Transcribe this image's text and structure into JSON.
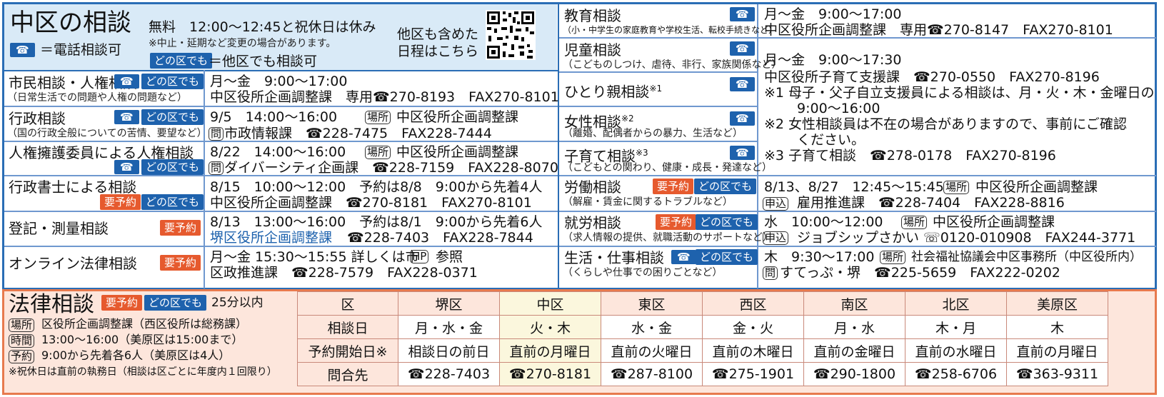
{
  "header": {
    "title": "中区の相談",
    "free_hours": "無料　12:00〜12:45と祝休日は休み",
    "change_note": "※中止・延期など変更の場合があります。",
    "tel_icon_label": "☎",
    "tel_legend": "＝電話相談可",
    "anywhere_label": "どの区でも",
    "anywhere_legend": "＝他区でも相談可",
    "schedule_line1": "他区も含めた",
    "schedule_line2": "日程はこちら"
  },
  "badges": {
    "tel": "☎",
    "anywhere": "どの区でも",
    "reserve": "要予約"
  },
  "left_rows": [
    {
      "title": "市民相談・人権相談",
      "sub": "（日常生活での問題や人権の問題など）",
      "line1": "月〜金　9:00〜17:00",
      "line2": "中区役所企画調整課　専用☎270-8193　FAX270-8101"
    },
    {
      "title": "行政相談",
      "sub": "（国の行政全般についての苦情、要望など）",
      "line1a": "9/5　14:00〜16:00",
      "place": "場所",
      "line1b": "中区役所企画調整課",
      "ask": "問",
      "line2": "市政情報課　☎228-7475　FAX228-7444"
    },
    {
      "title": "人権擁護委員による人権相談",
      "line1a": "8/22　14:00〜16:00",
      "place": "場所",
      "line1b": "中区役所企画調整課",
      "ask": "問",
      "line2": "ダイバーシティ企画課　☎228-7159　FAX228-8070"
    },
    {
      "title": "行政書士による相談",
      "line1": "8/15　10:00〜12:00　予約は8/8　9:00から先着4人",
      "line2": "中区役所企画調整課　☎270-8181　FAX270-8101"
    },
    {
      "title": "登記・測量相談",
      "line1": "8/13　13:00〜16:00　予約は8/1　9:00から先着6人",
      "line2a": "堺区役所企画調整課",
      "line2b": "☎228-7403　FAX228-7844"
    },
    {
      "title": "オンライン法律相談",
      "line1a": "月〜金 15:30〜15:55 詳しくは市",
      "hp": "HP",
      "line1b": "参照",
      "line2": "区政推進課　☎228-7579　FAX228-0371"
    }
  ],
  "right_rows": [
    {
      "title": "教育相談",
      "sub": "（小・中学生の家庭教育や学校生活、転校手続きなど）",
      "line1": "月〜金　9:00〜17:00",
      "line2": "中区役所企画調整課　専用☎270-8147　FAX270-8101"
    },
    {
      "title": "児童相談",
      "sub": "（こどものしつけ、虐待、非行、家族関係など）"
    },
    {
      "title": "ひとり親相談",
      "mark": "※1"
    },
    {
      "title": "女性相談",
      "mark": "※2",
      "sub": "（離婚、配偶者からの暴力、生活など）"
    },
    {
      "title": "子育て相談",
      "mark": "※3",
      "sub": "（こどもとの関わり、健康・成長・発達など）"
    },
    {
      "title": "労働相談",
      "sub": "（解雇・賃金に関するトラブルなど）",
      "line1a": "8/13、8/27　12:45〜15:45",
      "place": "場所",
      "line1b": "中区役所企画調整課",
      "apply": "申込",
      "line2": "雇用推進課　☎228-7404　FAX228-8816"
    },
    {
      "title": "就労相談",
      "sub": "（求人情報の提供、就職活動のサポートなど）",
      "line1a": "水　10:00〜12:00",
      "place": "場所",
      "line1b": "中区役所企画調整課",
      "apply": "申込",
      "line2": "ジョブシップさかい ☏0120-010908　FAX244-3771"
    },
    {
      "title": "生活・仕事相談",
      "sub": "（くらしや仕事での困りごとなど）",
      "line1a": "木　9:30〜17:00",
      "place": "場所",
      "line1b": "社会福祉協議会中区事務所（中区役所内）",
      "ask": "問",
      "line2": "すてっぷ・堺　☎225-5659　FAX222-0202"
    }
  ],
  "child_block": {
    "l1": "月〜金　9:00〜17:30",
    "l2": "中区役所子育て支援課　☎270-0550　FAX270-8196",
    "l3": "※1 母子・父子自立支援員による相談は、月・火・木・金曜日の",
    "l4": "9:00〜16:00",
    "l5": "※2 女性相談員は不在の場合がありますので、事前にご確認",
    "l6": "ください。",
    "l7": "※3 子育て相談　☎278-0178　FAX270-8196"
  },
  "law": {
    "title": "法律相談",
    "duration": "25分以内",
    "place_tag": "場所",
    "place": "区役所企画調整課（西区役所は総務課）",
    "time_tag": "時間",
    "time": "13:00〜16:00（美原区は15:00まで）",
    "resv_tag": "予約",
    "resv": "9:00から先着各6人（美原区は4人）",
    "note": "※祝休日は直前の執務日（相談は区ごとに年度内１回限り）",
    "table": {
      "header": [
        "区",
        "堺区",
        "中区",
        "東区",
        "西区",
        "南区",
        "北区",
        "美原区"
      ],
      "rows": [
        [
          "相談日",
          "月・水・金",
          "火・木",
          "水・金",
          "金・火",
          "月・水",
          "木・月",
          "木"
        ],
        [
          "予約開始日※",
          "相談日の前日",
          "直前の月曜日",
          "直前の火曜日",
          "直前の木曜日",
          "直前の金曜日",
          "直前の水曜日",
          "直前の月曜日"
        ],
        [
          "問合先",
          "☎228-7403",
          "☎270-8181",
          "☎287-8100",
          "☎275-1901",
          "☎290-1800",
          "☎258-6706",
          "☎363-9311"
        ]
      ]
    }
  }
}
